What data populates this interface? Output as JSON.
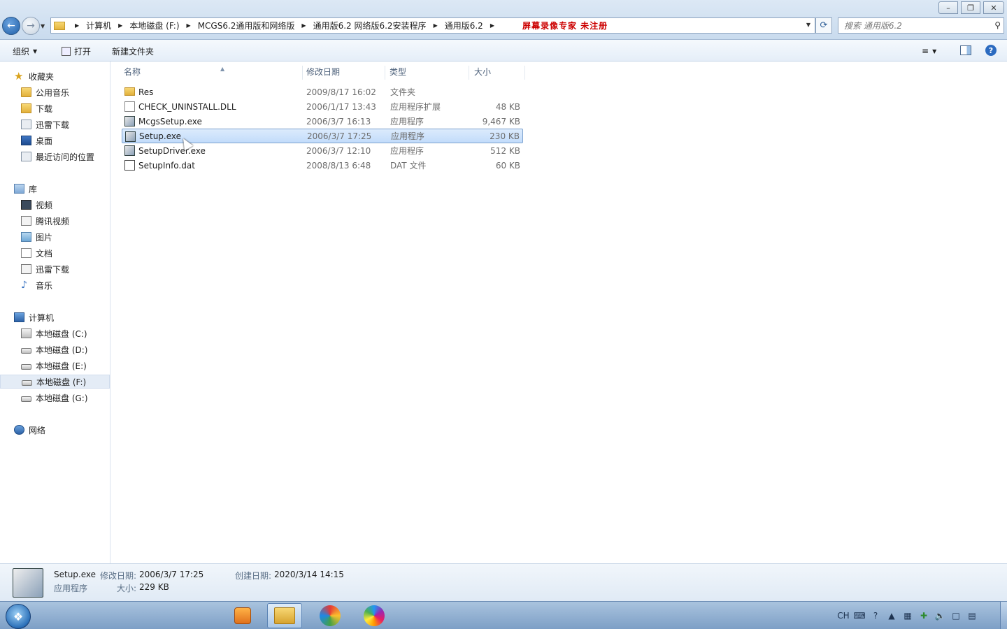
{
  "window": {
    "minimize_label": "–",
    "maximize_label": "❐",
    "close_label": "✕"
  },
  "address": {
    "crumbs": [
      "计算机",
      "本地磁盘 (F:)",
      "MCGS6.2通用版和网络版",
      "通用版6.2 网络版6.2安装程序",
      "通用版6.2"
    ],
    "watermark": "屏幕录像专家  未注册"
  },
  "search": {
    "placeholder": "搜索 通用版6.2"
  },
  "toolbar": {
    "organize_label": "组织",
    "open_label": "打开",
    "newfolder_label": "新建文件夹"
  },
  "nav": {
    "favorites": {
      "label": "收藏夹",
      "items": [
        "公用音乐",
        "下载",
        "迅雷下载",
        "桌面",
        "最近访问的位置"
      ]
    },
    "libraries": {
      "label": "库",
      "items": [
        "视频",
        "腾讯视频",
        "图片",
        "文档",
        "迅雷下载",
        "音乐"
      ]
    },
    "computer": {
      "label": "计算机",
      "items": [
        "本地磁盘 (C:)",
        "本地磁盘 (D:)",
        "本地磁盘 (E:)",
        "本地磁盘 (F:)",
        "本地磁盘 (G:)"
      ],
      "selected": "本地磁盘 (F:)"
    },
    "network": {
      "label": "网络"
    }
  },
  "columns": {
    "name": "名称",
    "date": "修改日期",
    "type": "类型",
    "size": "大小"
  },
  "files": [
    {
      "name": "Res",
      "date": "2009/8/17 16:02",
      "type": "文件夹",
      "size": "",
      "icon": "folder-icon"
    },
    {
      "name": "CHECK_UNINSTALL.DLL",
      "date": "2006/1/17 13:43",
      "type": "应用程序扩展",
      "size": "48 KB",
      "icon": "dll-file-icon"
    },
    {
      "name": "McgsSetup.exe",
      "date": "2006/3/7 16:13",
      "type": "应用程序",
      "size": "9,467 KB",
      "icon": "setup-exe-icon"
    },
    {
      "name": "Setup.exe",
      "date": "2006/3/7 17:25",
      "type": "应用程序",
      "size": "230 KB",
      "icon": "setup-exe-icon"
    },
    {
      "name": "SetupDriver.exe",
      "date": "2006/3/7 12:10",
      "type": "应用程序",
      "size": "512 KB",
      "icon": "setup-exe-icon"
    },
    {
      "name": "SetupInfo.dat",
      "date": "2008/8/13 6:48",
      "type": "DAT 文件",
      "size": "60 KB",
      "icon": "dat-file-icon"
    }
  ],
  "selected_file": "Setup.exe",
  "details": {
    "name": "Setup.exe",
    "type": "应用程序",
    "modified_label": "修改日期:",
    "modified": "2006/3/7 17:25",
    "created_label": "创建日期:",
    "created": "2020/3/14 14:15",
    "size_label": "大小:",
    "size": "229 KB"
  },
  "taskbar": {
    "tray_lang": "CH"
  }
}
